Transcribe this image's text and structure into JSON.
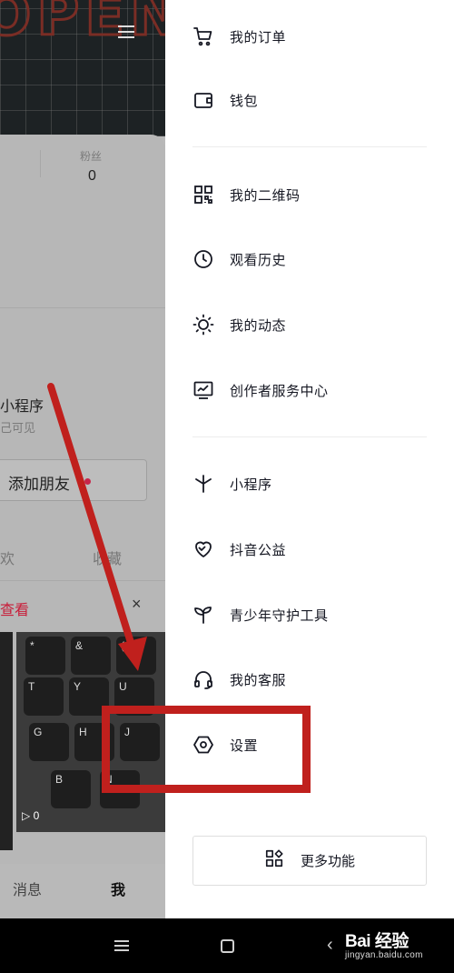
{
  "background_page": {
    "fans_label": "粉丝",
    "fans_count": "0",
    "mini_program_title": "小程序",
    "visible_hint": "己可见",
    "add_friend_label": "添加朋友",
    "tab_likes": "欢",
    "tab_favorites": "收藏",
    "view_link": "查看",
    "close_icon": "×",
    "play_count": "0",
    "nav_messages": "消息",
    "nav_me": "我"
  },
  "drawer": {
    "items": [
      {
        "label": "我的订单",
        "icon": "cart-icon"
      },
      {
        "label": "钱包",
        "icon": "wallet-icon"
      },
      {
        "label": "我的二维码",
        "icon": "qrcode-icon"
      },
      {
        "label": "观看历史",
        "icon": "clock-icon"
      },
      {
        "label": "我的动态",
        "icon": "sun-icon"
      },
      {
        "label": "创作者服务中心",
        "icon": "chart-monitor-icon"
      },
      {
        "label": "小程序",
        "icon": "mini-program-icon"
      },
      {
        "label": "抖音公益",
        "icon": "heart-icon"
      },
      {
        "label": "青少年守护工具",
        "icon": "sprout-icon"
      },
      {
        "label": "我的客服",
        "icon": "headset-icon"
      },
      {
        "label": "设置",
        "icon": "settings-hexagon-icon"
      }
    ],
    "more_button": "更多功能"
  },
  "watermark": {
    "brand": "Bai 经验",
    "url": "jingyan.baidu.com"
  },
  "colors": {
    "highlight": "#c0201d",
    "accent_red": "#c81e3a",
    "text": "#161823"
  }
}
